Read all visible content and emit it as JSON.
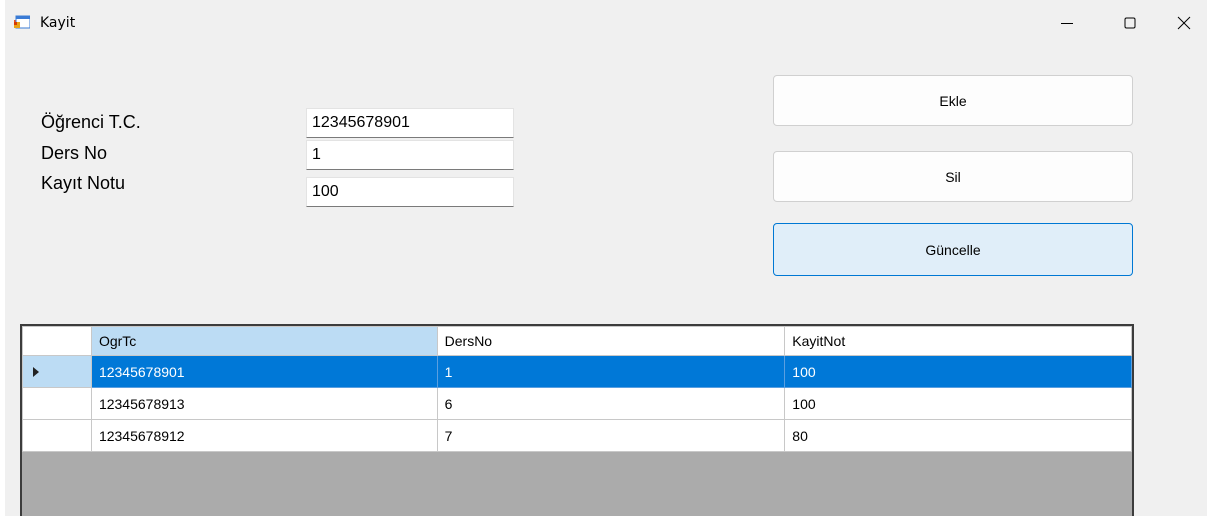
{
  "window": {
    "title": "Kayit"
  },
  "form": {
    "tc_label": "Öğrenci T.C.",
    "tc_value": "12345678901",
    "ders_label": "Ders No",
    "ders_value": "1",
    "not_label": "Kayıt Notu",
    "not_value": "100"
  },
  "buttons": {
    "ekle": "Ekle",
    "sil": "Sil",
    "guncelle": "Güncelle"
  },
  "grid": {
    "columns": [
      "OgrTc",
      "DersNo",
      "KayitNot"
    ],
    "rows": [
      [
        "12345678901",
        "1",
        "100"
      ],
      [
        "12345678913",
        "6",
        "100"
      ],
      [
        "12345678912",
        "7",
        "80"
      ]
    ],
    "selected_row": 0
  },
  "colors": {
    "selection": "#0078d7",
    "focus_border": "#0078d4",
    "grid_background": "#ababab"
  }
}
